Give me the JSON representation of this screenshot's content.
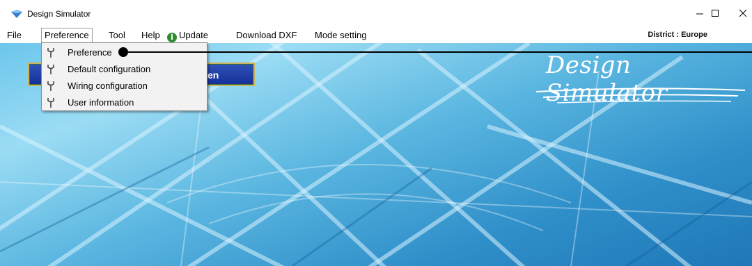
{
  "window": {
    "title": "Design Simulator",
    "controls": [
      "minimize",
      "maximize",
      "close"
    ]
  },
  "menubar": {
    "items": [
      {
        "label": "File"
      },
      {
        "label": "Preference"
      },
      {
        "label": "Tool"
      },
      {
        "label": "Help"
      },
      {
        "label": "Update",
        "icon": "info-icon"
      },
      {
        "label": "Download DXF"
      },
      {
        "label": "Mode setting"
      }
    ],
    "district": "District : Europe"
  },
  "dropdown": {
    "open_menu": "Preference",
    "items": [
      {
        "label": "Preference",
        "icon": "wrench-icon"
      },
      {
        "label": "Default configuration",
        "icon": "wrench-icon"
      },
      {
        "label": "Wiring configuration",
        "icon": "wrench-icon"
      },
      {
        "label": "User information",
        "icon": "wrench-icon"
      }
    ]
  },
  "main": {
    "brand": "Design Simulator",
    "partial_button_text": "en"
  },
  "colors": {
    "background_accent": "#5ab6e0",
    "button_blue": "#1a3aa6",
    "button_border": "#c9b45a",
    "update_icon": "#2e8b2e"
  }
}
